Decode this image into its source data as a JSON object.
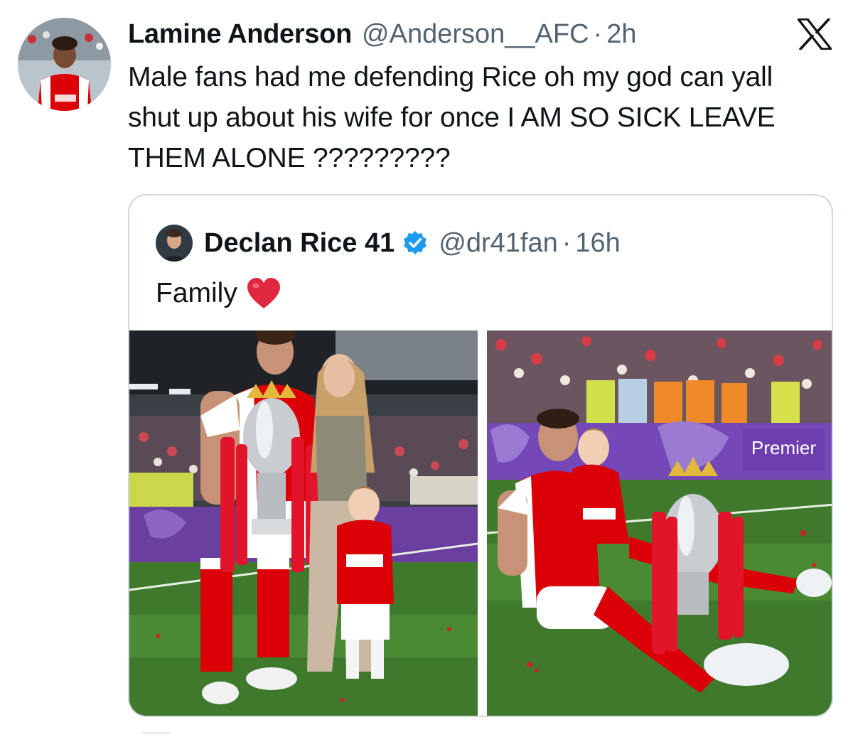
{
  "tweet": {
    "author_name": "Lamine Anderson",
    "author_handle": "@Anderson__AFC",
    "separator": "·",
    "time": "2h",
    "text": "Male fans had me defending Rice oh my god can yall shut up about his wife for once I AM SO SICK LEAVE THEM ALONE ?????????",
    "avatar_icon": "profile-photo-arsenal-player",
    "platform_icon": "x-logo-icon"
  },
  "quoted_tweet": {
    "author_name": "Declan Rice 41",
    "verified_icon": "verified-badge-icon",
    "author_handle": "@dr41fan",
    "separator": "·",
    "time": "16h",
    "text": "Family",
    "emoji_icon": "red-heart-icon",
    "photos": [
      {
        "icon": "photo-family-with-trophy"
      },
      {
        "icon": "photo-player-sitting-with-child-and-trophy"
      }
    ]
  },
  "colors": {
    "text_primary": "#0f1419",
    "text_secondary": "#536471",
    "border": "#cfd9de",
    "verified_blue": "#1d9bf0",
    "arsenal_red": "#db0007",
    "heart_red": "#e0273d",
    "pitch_green": "#3f7a2c",
    "pl_purple": "#3d195b"
  }
}
